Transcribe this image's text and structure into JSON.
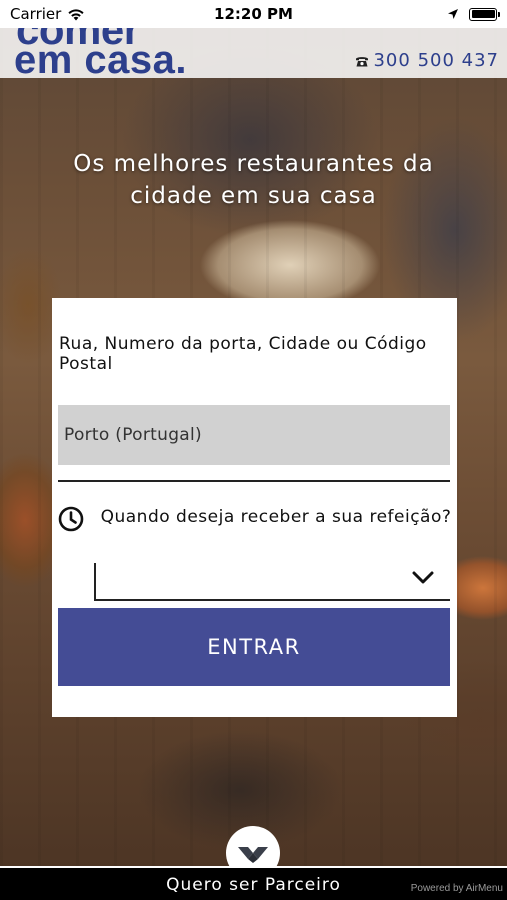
{
  "status_bar": {
    "carrier": "Carrier",
    "time": "12:20 PM"
  },
  "header": {
    "logo_line1": "comer",
    "logo_line2": "em casa.",
    "phone": "300 500 437",
    "brand_color": "#2d3f8c"
  },
  "hero": {
    "tagline": "Os melhores restaurantes da cidade em sua casa"
  },
  "form": {
    "address_label": "Rua, Numero da porta, Cidade ou Código Postal",
    "address_value": "Porto (Portugal)",
    "time_question": "Quando deseja receber a sua refeição?",
    "time_value": "",
    "submit_label": "ENTRAR",
    "button_color": "#444c95"
  },
  "footer": {
    "partner_label": "Quero ser Parceiro",
    "powered_by": "Powered by AirMenu"
  }
}
